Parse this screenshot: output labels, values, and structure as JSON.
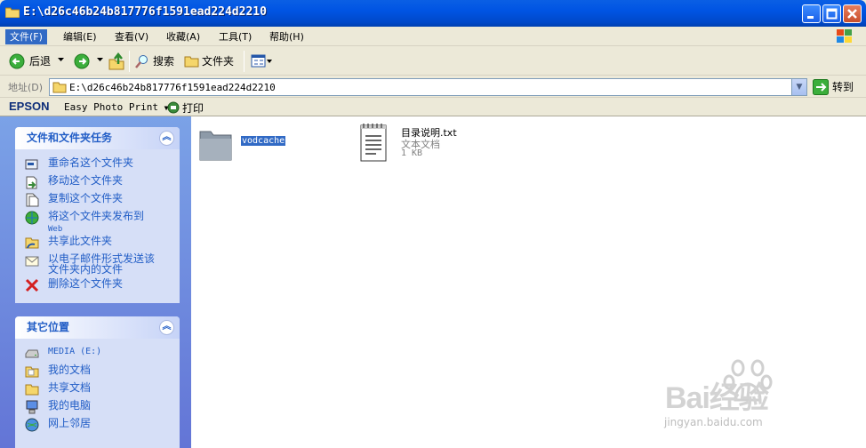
{
  "window": {
    "title": "E:\\d26c46b24b817776f1591ead224d2210"
  },
  "menu": [
    {
      "label": "文件(F)"
    },
    {
      "label": "编辑(E)"
    },
    {
      "label": "查看(V)"
    },
    {
      "label": "收藏(A)"
    },
    {
      "label": "工具(T)"
    },
    {
      "label": "帮助(H)"
    }
  ],
  "toolbar": {
    "back": "后退",
    "search": "搜索",
    "folders": "文件夹"
  },
  "address": {
    "label": "地址(D)",
    "value": "E:\\d26c46b24b817776f1591ead224d2210",
    "go": "转到"
  },
  "epson": {
    "logo": "EPSON",
    "easy": "Easy Photo Print",
    "print": "打印"
  },
  "tasks": {
    "title": "文件和文件夹任务",
    "items": [
      {
        "label": "重命名这个文件夹",
        "icon": "rename-icon"
      },
      {
        "label": "移动这个文件夹",
        "icon": "move-icon"
      },
      {
        "label": "复制这个文件夹",
        "icon": "copy-icon"
      },
      {
        "label": "将这个文件夹发布到",
        "sub": "Web",
        "icon": "web-publish-icon"
      },
      {
        "label": "共享此文件夹",
        "icon": "share-icon"
      },
      {
        "label": "以电子邮件形式发送该",
        "sub": "文件夹内的文件",
        "icon": "email-icon"
      },
      {
        "label": "删除这个文件夹",
        "icon": "delete-icon"
      }
    ]
  },
  "places": {
    "title": "其它位置",
    "items": [
      {
        "label": "MEDIA (E:)",
        "icon": "drive-icon"
      },
      {
        "label": "我的文档",
        "icon": "my-documents-icon"
      },
      {
        "label": "共享文档",
        "icon": "shared-documents-icon"
      },
      {
        "label": "我的电脑",
        "icon": "my-computer-icon"
      },
      {
        "label": "网上邻居",
        "icon": "network-icon"
      }
    ]
  },
  "files": [
    {
      "name": "vodcache",
      "icon": "folder-icon"
    },
    {
      "name": "目录说明.txt",
      "type": "文本文档",
      "size": "1 KB",
      "icon": "text-file-icon"
    }
  ],
  "watermark": {
    "text": "Bai经验",
    "url": "jingyan.baidu.com"
  },
  "colors": {
    "titlebar": "#0054e3",
    "selection": "#316ac5",
    "taskpane": "#6375d6",
    "link": "#215dc6"
  }
}
